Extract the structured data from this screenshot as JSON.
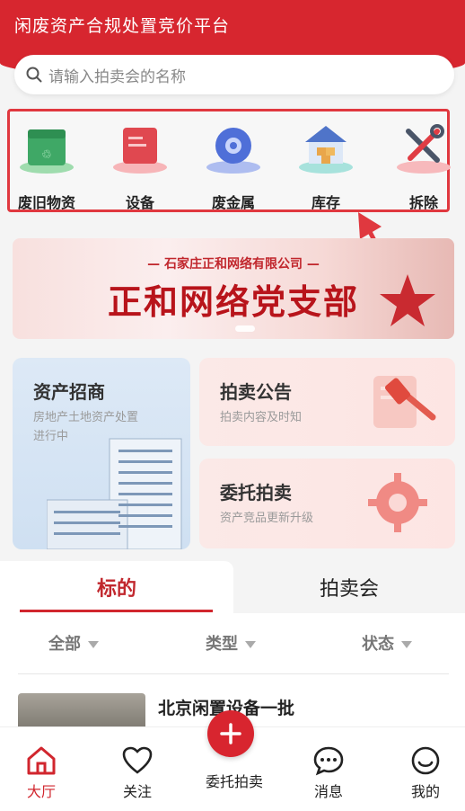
{
  "header": {
    "title": "闲废资产合规处置竞价平台"
  },
  "search": {
    "placeholder": "请输入拍卖会的名称"
  },
  "categories": [
    {
      "label": "废旧物资",
      "icon": "recycle-box-icon"
    },
    {
      "label": "设备",
      "icon": "equipment-icon"
    },
    {
      "label": "废金属",
      "icon": "gear-metal-icon"
    },
    {
      "label": "库存",
      "icon": "warehouse-icon"
    },
    {
      "label": "拆除",
      "icon": "tools-icon"
    }
  ],
  "banner": {
    "subtitle": "— 石家庄正和网络有限公司 —",
    "title": "正和网络党支部"
  },
  "cards": {
    "assets": {
      "title": "资产招商",
      "subtitle_line1": "房地产土地资产处置",
      "subtitle_line2": "进行中"
    },
    "notice": {
      "title": "拍卖公告",
      "subtitle": "拍卖内容及时知"
    },
    "entrust": {
      "title": "委托拍卖",
      "subtitle": "资产竞品更新升级"
    }
  },
  "tabs": {
    "active": "标的",
    "other": "拍卖会"
  },
  "filters": {
    "all": "全部",
    "type": "类型",
    "status": "状态"
  },
  "list": {
    "first_item_title": "北京闲置设备一批"
  },
  "tabbar": {
    "home": "大厅",
    "follow": "关注",
    "entrust": "委托拍卖",
    "messages": "消息",
    "mine": "我的"
  },
  "colors": {
    "brand": "#d7262f",
    "highlight_box": "#e0383f"
  }
}
